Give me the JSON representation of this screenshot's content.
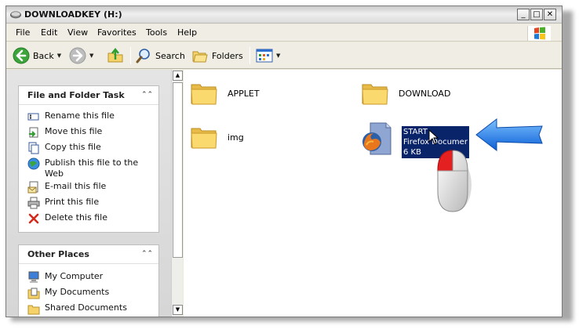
{
  "window": {
    "title": "DOWNLOADKEY (H:)",
    "buttons": {
      "minimize": "_",
      "maximize": "□",
      "close": "✕"
    }
  },
  "menu": [
    {
      "label": "File"
    },
    {
      "label": "Edit"
    },
    {
      "label": "View"
    },
    {
      "label": "Favorites"
    },
    {
      "label": "Tools"
    },
    {
      "label": "Help"
    }
  ],
  "toolbar": {
    "back_label": "Back",
    "search_label": "Search",
    "folders_label": "Folders"
  },
  "tasks_panel": {
    "title": "File and  Folder Task",
    "items": [
      {
        "label": "Rename this file",
        "icon": "rename-icon"
      },
      {
        "label": "Move this file",
        "icon": "move-icon"
      },
      {
        "label": "Copy this file",
        "icon": "copy-icon"
      },
      {
        "label": "Publish this file to the Web",
        "icon": "publish-web-icon"
      },
      {
        "label": "E-mail this file",
        "icon": "email-icon"
      },
      {
        "label": "Print this file",
        "icon": "print-icon"
      },
      {
        "label": "Delete this file",
        "icon": "delete-icon"
      }
    ]
  },
  "places_panel": {
    "title": "Other Places",
    "items": [
      {
        "label": "My Computer",
        "icon": "computer-icon"
      },
      {
        "label": "My Documents",
        "icon": "documents-icon"
      },
      {
        "label": "Shared Documents",
        "icon": "shared-folder-icon"
      }
    ]
  },
  "files": [
    {
      "name": "APPLET",
      "type": "folder"
    },
    {
      "name": "DOWNLOAD",
      "type": "folder"
    },
    {
      "name": "img",
      "type": "folder"
    },
    {
      "name": "START",
      "type": "Firefox Document",
      "size": "6 KB",
      "selected": true
    }
  ],
  "colors": {
    "selection": "#0a246a",
    "annotation_arrow": "#1e78e6",
    "folder": "#f7d66a"
  }
}
